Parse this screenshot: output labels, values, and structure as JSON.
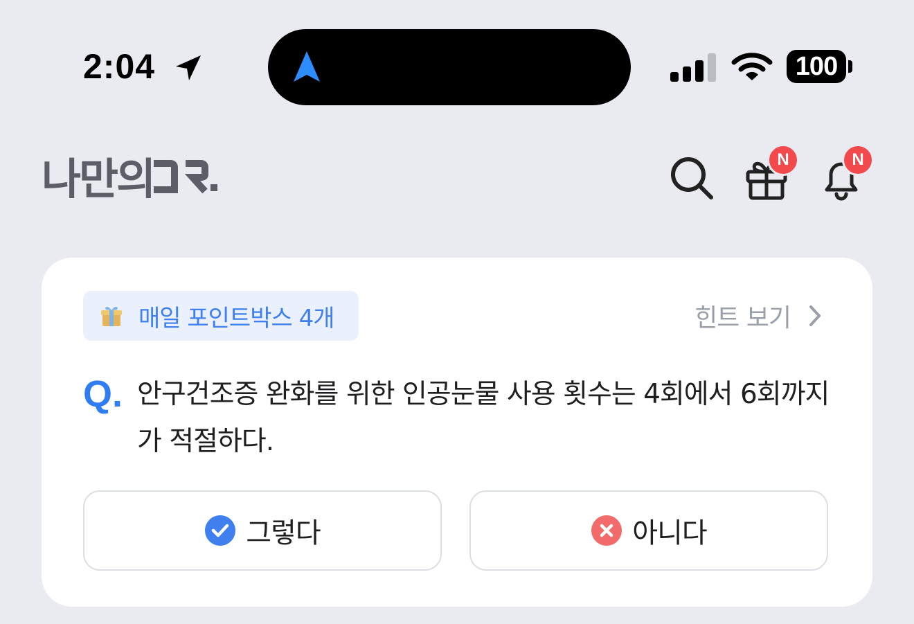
{
  "status_bar": {
    "time": "2:04",
    "battery": "100"
  },
  "header": {
    "logo_text": "나만의 DR.",
    "gift_badge": "N",
    "bell_badge": "N"
  },
  "quiz": {
    "pointbox_label": "매일 포인트박스 4개",
    "hint_label": "힌트 보기",
    "q_mark": "Q.",
    "question": "안구건조증 완화를 위한 인공눈물 사용 횟수는 4회에서 6회까지가 적절하다.",
    "answer_yes": "그렇다",
    "answer_no": "아니다"
  },
  "colors": {
    "background": "#e9ebf0",
    "accent": "#3f80ee",
    "badge": "#f2494c",
    "no_icon": "#f26b6b"
  }
}
